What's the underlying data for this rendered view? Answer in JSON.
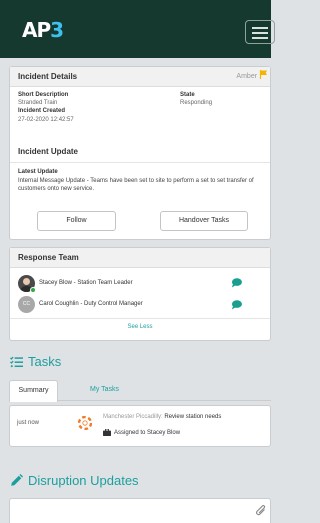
{
  "brand": {
    "logo_prefix": "AP",
    "logo_suffix": "3"
  },
  "incident": {
    "header": "Incident Details",
    "severity": "Amber",
    "severity_color": "#f4b400",
    "short_desc_label": "Short Description",
    "short_desc_value": "Stranded Train",
    "state_label": "State",
    "state_value": "Responding",
    "created_label": "Incident Created",
    "created_value": "27-02-2020 12:42:57",
    "update_header": "Incident Update",
    "latest_label": "Latest Update",
    "latest_value": "Internal Message Update - Teams have been set to site to perform a set to set transfer of customers onto new service.",
    "follow_label": "Follow",
    "handover_label": "Handover Tasks"
  },
  "team": {
    "header": "Response Team",
    "members": [
      {
        "name": "Stacey Blow - Station Team Leader",
        "initials": "",
        "status_color": "#2ea84a"
      },
      {
        "name": "Carol Coughlin - Duty Control Manager",
        "initials": "CC",
        "status_color": ""
      }
    ],
    "see_less": "See Less"
  },
  "tasks": {
    "title": "Tasks",
    "tabs": [
      "Summary",
      "My Tasks"
    ],
    "item": {
      "time": "just now",
      "location": "Manchester Piccadilly: ",
      "task": "Review station needs",
      "assigned": "Assigned to Stacey Blow"
    }
  },
  "disruption": {
    "title": "Disruption Updates"
  },
  "colors": {
    "accent": "#1d9e9e",
    "chat": "#1a9e8f",
    "topbar": "#15382f"
  }
}
